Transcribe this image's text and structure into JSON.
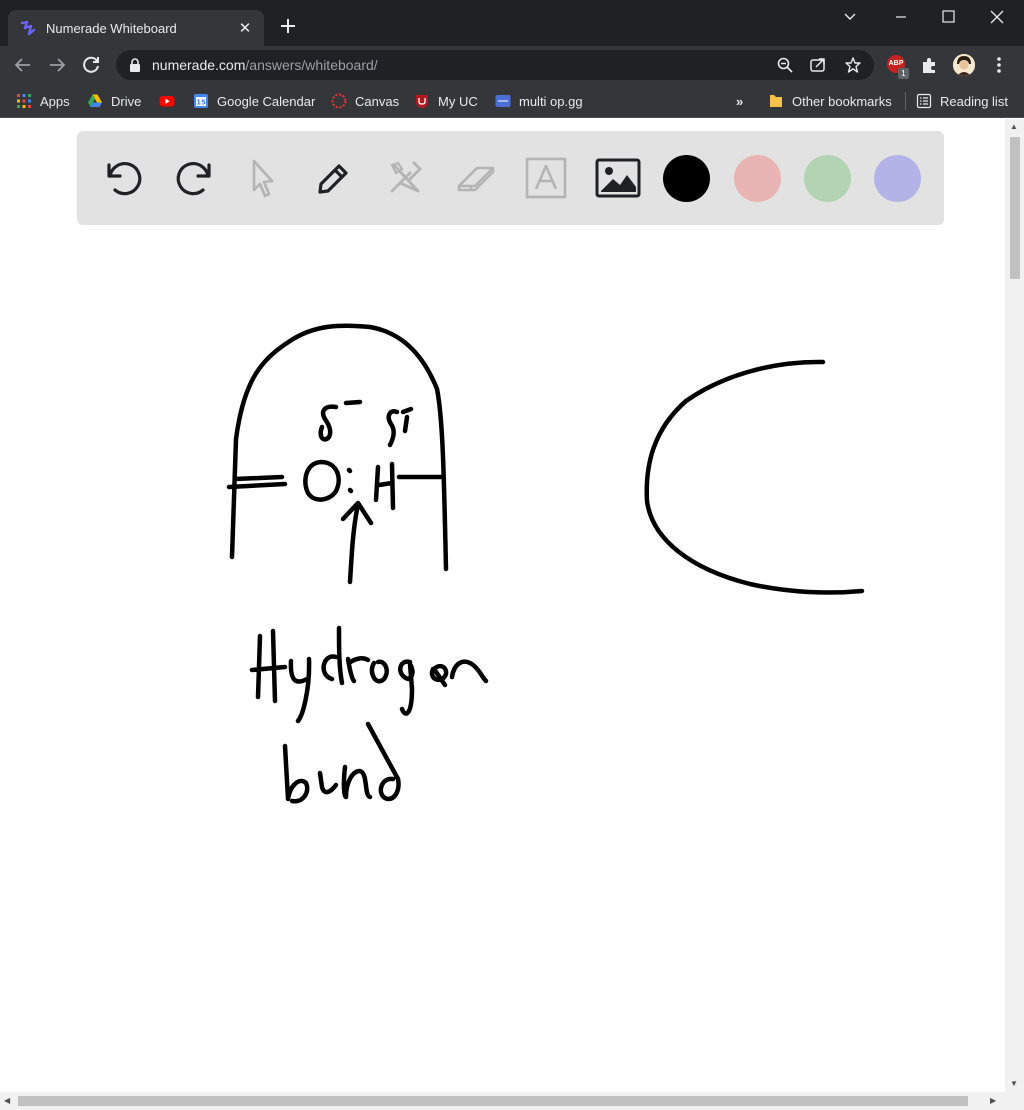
{
  "browser": {
    "tab": {
      "title": "Numerade Whiteboard"
    },
    "address": {
      "domain": "numerade.com",
      "path": "/answers/whiteboard/"
    },
    "extension_badge": {
      "label": "ABP",
      "count": "1"
    },
    "bookmarks": [
      {
        "label": "Apps",
        "icon": "apps-grid-icon"
      },
      {
        "label": "Drive",
        "icon": "drive-icon"
      },
      {
        "label": "",
        "icon": "youtube-icon"
      },
      {
        "label": "Google Calendar",
        "icon": "calendar-icon"
      },
      {
        "label": "Canvas",
        "icon": "canvas-icon"
      },
      {
        "label": "My UC",
        "icon": "uc-icon"
      },
      {
        "label": "multi op.gg",
        "icon": "opgg-icon"
      }
    ],
    "bookmarks_overflow": "»",
    "other_bookmarks": "Other bookmarks",
    "reading_list": "Reading list"
  },
  "whiteboard": {
    "tools": [
      "undo-icon",
      "redo-icon",
      "pointer-icon",
      "pen-icon",
      "tools-icon",
      "eraser-icon",
      "text-icon",
      "image-icon"
    ],
    "colors": [
      "#000000",
      "#e8b4b4",
      "#b3d4b3",
      "#b3b3e8"
    ],
    "selected_color": "#000000",
    "handwritten_text": [
      "δ⁻",
      "δ⁺",
      "O:",
      "H",
      "Hydrogen",
      "bond"
    ]
  }
}
